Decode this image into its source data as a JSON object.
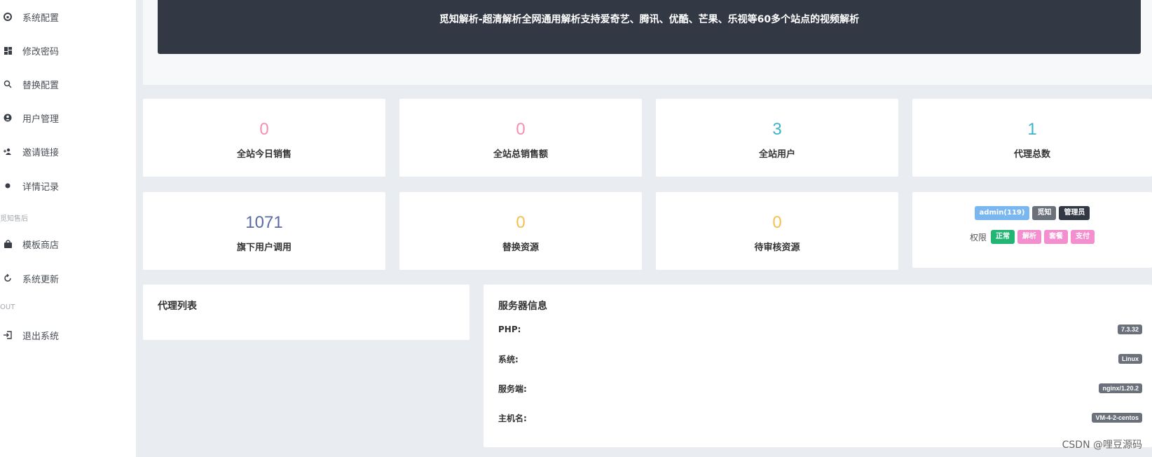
{
  "sidebar": {
    "items": [
      {
        "label": "系统配置",
        "icon": "home-icon"
      },
      {
        "label": "修改密码",
        "icon": "dashboard-icon"
      },
      {
        "label": "替换配置",
        "icon": "search-icon"
      },
      {
        "label": "用户管理",
        "icon": "user-icon"
      },
      {
        "label": "邀请链接",
        "icon": "user-add-icon"
      },
      {
        "label": "详情记录",
        "icon": "dot-icon"
      },
      {
        "label": "模板商店",
        "icon": "bag-icon"
      },
      {
        "label": "系统更新",
        "icon": "refresh-icon"
      },
      {
        "label": "退出系统",
        "icon": "logout-icon"
      }
    ],
    "groups": [
      "觅知售后",
      "OUT"
    ]
  },
  "banner": {
    "text": "觅知解析-超清解析全网通用解析支持爱奇艺、腾讯、优酷、芒果、乐视等60多个站点的视频解析"
  },
  "stats": [
    {
      "value": "0",
      "label": "全站今日销售",
      "color": "#f48fb1"
    },
    {
      "value": "0",
      "label": "全站总销售额",
      "color": "#f48fb1"
    },
    {
      "value": "3",
      "label": "全站用户",
      "color": "#3bb4c8"
    },
    {
      "value": "1",
      "label": "代理总数",
      "color": "#3bb4c8"
    },
    {
      "value": "1071",
      "label": "旗下用户调用",
      "color": "#5b6aa8"
    },
    {
      "value": "0",
      "label": "替换资源",
      "color": "#f2c14e"
    },
    {
      "value": "0",
      "label": "待审核资源",
      "color": "#f2c14e"
    }
  ],
  "user_card": {
    "badges": [
      {
        "text": "admin(119)",
        "color": "#7ab7f0"
      },
      {
        "text": "觅知",
        "color": "#6b717a"
      },
      {
        "text": "管理员",
        "color": "#323844"
      }
    ],
    "perm_label": "权限",
    "perms": [
      {
        "text": "正常",
        "color": "#22b573"
      },
      {
        "text": "解析",
        "color": "#f48fcf"
      },
      {
        "text": "套餐",
        "color": "#f48fcf"
      },
      {
        "text": "支付",
        "color": "#f48fcf"
      }
    ]
  },
  "agent_panel": {
    "title": "代理列表"
  },
  "server_panel": {
    "title": "服务器信息",
    "rows": [
      {
        "key": "PHP:",
        "value": "7.3.32"
      },
      {
        "key": "系统:",
        "value": "Linux"
      },
      {
        "key": "服务端:",
        "value": "nginx/1.20.2"
      },
      {
        "key": "主机名:",
        "value": "VM-4-2-centos"
      }
    ]
  },
  "watermark": "CSDN @哩豆源码"
}
